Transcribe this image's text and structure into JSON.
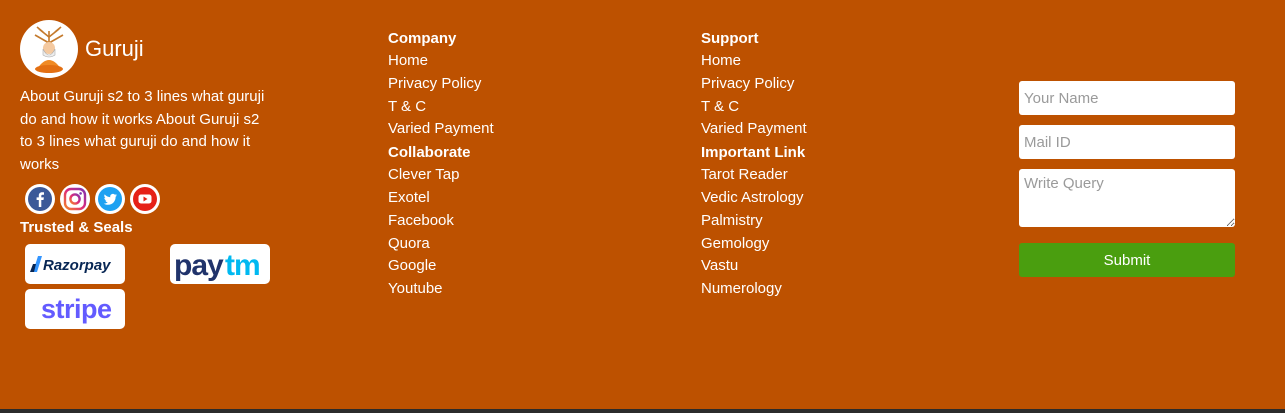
{
  "brand": {
    "name": "Guruji",
    "about": "About Guruji s2 to 3 lines what guruji do and how it works About Guruji s2 to 3 lines what guruji do and how it works"
  },
  "socials": [
    {
      "icon": "facebook-icon",
      "color": "#3b5998"
    },
    {
      "icon": "instagram-icon",
      "color": "#c13584"
    },
    {
      "icon": "twitter-icon",
      "color": "#1da1f2"
    },
    {
      "icon": "youtube-icon",
      "color": "#e62117"
    }
  ],
  "trusted": {
    "heading": "Trusted & Seals",
    "seals": [
      "Razorpay",
      "Paytm",
      "stripe"
    ]
  },
  "company": {
    "heading": "Company",
    "links": [
      "Home",
      "Privacy Policy",
      "T & C",
      "Varied Payment"
    ]
  },
  "collaborate": {
    "heading": "Collaborate",
    "links": [
      "Clever Tap",
      "Exotel",
      "Facebook",
      "Quora",
      "Google",
      "Youtube"
    ]
  },
  "support": {
    "heading": "Support",
    "links": [
      "Home",
      "Privacy Policy",
      "T & C",
      "Varied Payment"
    ]
  },
  "important": {
    "heading": "Important Link",
    "links": [
      "Tarot Reader",
      "Vedic Astrology",
      "Palmistry",
      "Gemology",
      "Vastu",
      "Numerology"
    ]
  },
  "form": {
    "name_placeholder": "Your Name",
    "mail_placeholder": "Mail ID",
    "query_placeholder": "Write Query",
    "submit_label": "Submit"
  },
  "colors": {
    "footer_bg": "#bd5100",
    "submit_bg": "#4a9e0f"
  }
}
